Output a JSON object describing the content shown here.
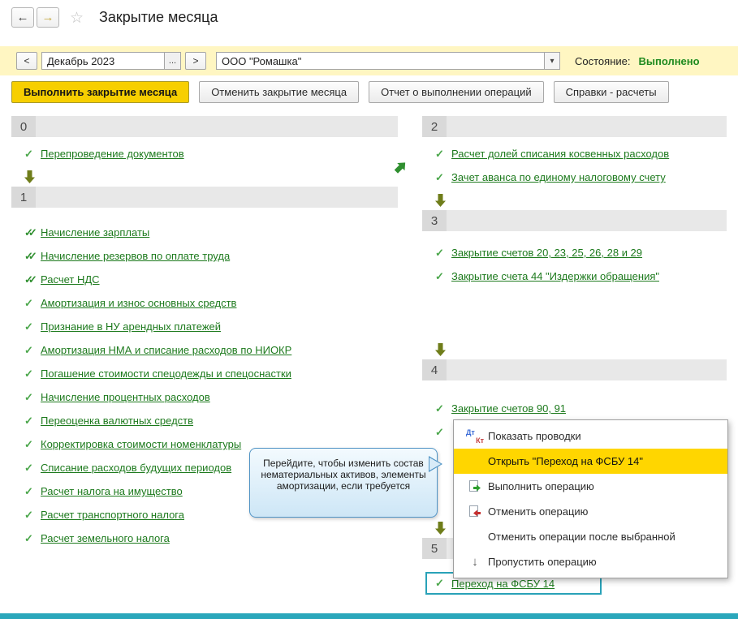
{
  "window": {
    "title": "Закрытие месяца"
  },
  "toolbar": {
    "prev_label": "<",
    "period": "Декабрь 2023",
    "ellipsis": "...",
    "next_label": ">",
    "organization": "ООО \"Ромашка\"",
    "status_label": "Состояние:",
    "status_value": "Выполнено"
  },
  "actions": {
    "run": "Выполнить закрытие месяца",
    "cancel": "Отменить закрытие месяца",
    "report": "Отчет о выполнении операций",
    "refs": "Справки - расчеты"
  },
  "sections": [
    {
      "number": "0",
      "items": [
        {
          "label": "Перепроведение документов",
          "check": "single"
        }
      ]
    },
    {
      "number": "1",
      "items": [
        {
          "label": "Начисление зарплаты",
          "check": "double"
        },
        {
          "label": "Начисление резервов по оплате труда",
          "check": "double"
        },
        {
          "label": "Расчет НДС",
          "check": "double"
        },
        {
          "label": "Амортизация и износ основных средств",
          "check": "single"
        },
        {
          "label": "Признание в НУ арендных платежей",
          "check": "single"
        },
        {
          "label": "Амортизация НМА и списание расходов по НИОКР",
          "check": "single"
        },
        {
          "label": "Погашение стоимости спецодежды и спецоснастки",
          "check": "single"
        },
        {
          "label": "Начисление процентных расходов",
          "check": "single"
        },
        {
          "label": "Переоценка валютных средств",
          "check": "single"
        },
        {
          "label": "Корректировка стоимости номенклатуры",
          "check": "single"
        },
        {
          "label": "Списание расходов будущих периодов",
          "check": "single"
        },
        {
          "label": "Расчет налога на имущество",
          "check": "single"
        },
        {
          "label": "Расчет транспортного налога",
          "check": "single"
        },
        {
          "label": "Расчет земельного налога",
          "check": "single"
        }
      ]
    },
    {
      "number": "2",
      "items": [
        {
          "label": "Расчет долей списания косвенных расходов",
          "check": "single"
        },
        {
          "label": "Зачет аванса по единому налоговому счету",
          "check": "single"
        }
      ]
    },
    {
      "number": "3",
      "items": [
        {
          "label": "Закрытие счетов 20, 23, 25, 26, 28 и 29",
          "check": "single"
        },
        {
          "label": "Закрытие счета 44 \"Издержки обращения\"",
          "check": "single"
        }
      ]
    },
    {
      "number": "4",
      "items": [
        {
          "label": "Закрытие счетов 90, 91",
          "check": "single"
        },
        {
          "label": "",
          "check": "single"
        }
      ]
    },
    {
      "number": "5",
      "items": [
        {
          "label": "Переход на ФСБУ 14",
          "check": "single"
        }
      ]
    }
  ],
  "context_menu": {
    "dtkt": {
      "debit": "Дт",
      "credit": "Кт"
    },
    "items": [
      {
        "label": "Показать проводки"
      },
      {
        "label": "Открыть \"Переход на ФСБУ 14\"",
        "highlighted": true
      },
      {
        "label": "Выполнить операцию"
      },
      {
        "label": "Отменить операцию"
      },
      {
        "label": "Отменить операции после выбранной"
      },
      {
        "label": "Пропустить операцию"
      }
    ]
  },
  "callout": {
    "text": "Перейдите, чтобы изменить состав нематериальных активов, элементы амортизации, если требуется"
  },
  "colors": {
    "accent_yellow": "#ffd600",
    "toolbar_yellow": "#fff6c2",
    "status_green": "#1f8a1f",
    "link_green": "#1d7a1d",
    "highlight_teal": "#29a2b8",
    "bottom_bar_teal": "#2aa7bb"
  }
}
